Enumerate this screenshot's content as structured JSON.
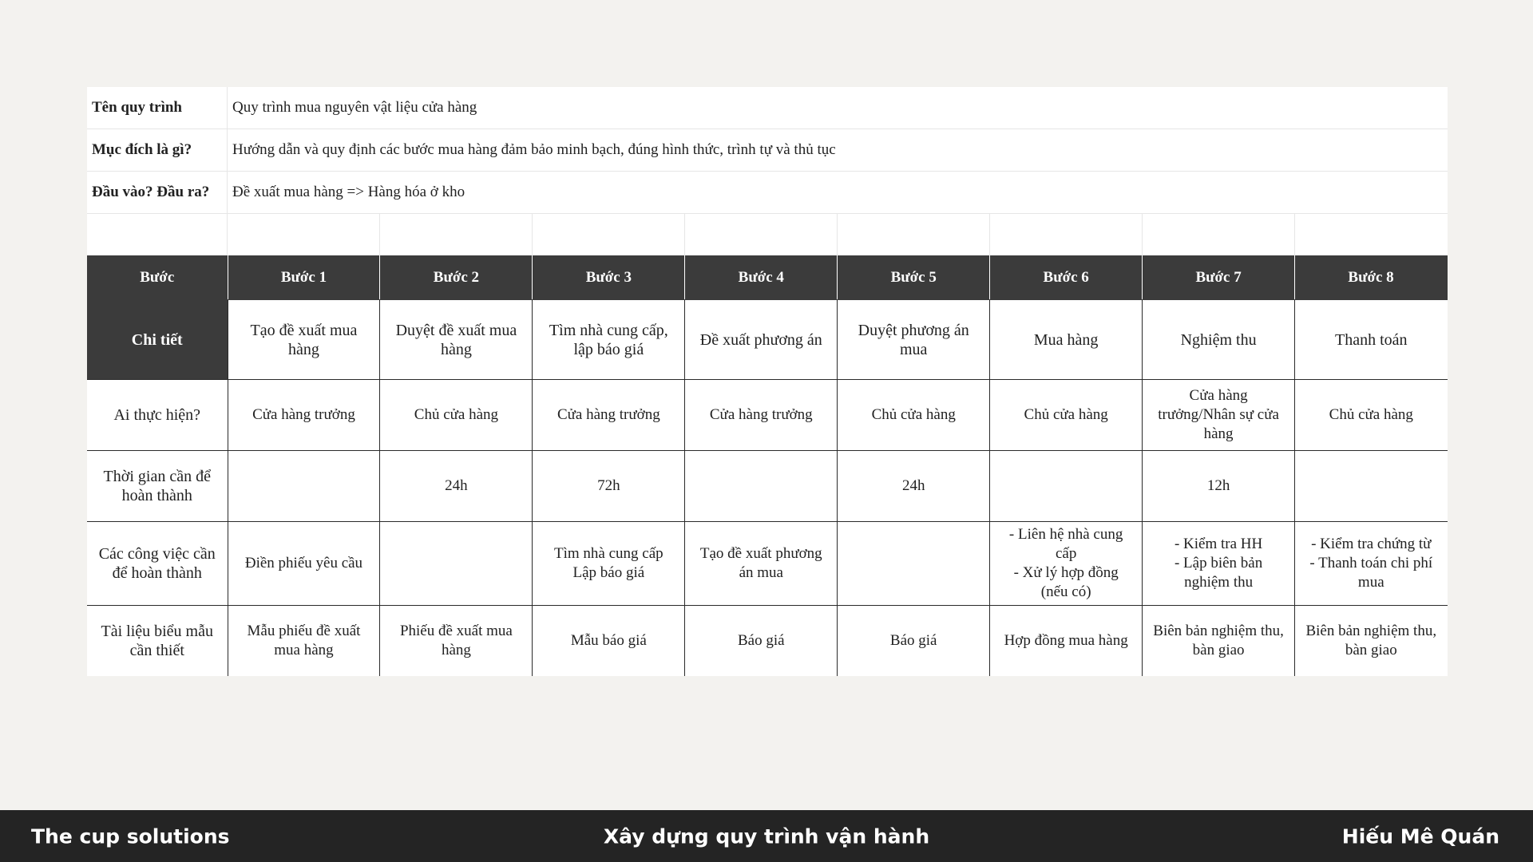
{
  "meta": [
    {
      "label": "Tên quy trình",
      "value": "Quy trình mua nguyên vật liệu cửa hàng"
    },
    {
      "label": "Mục đích là gì?",
      "value": "Hướng dẫn và quy định các bước mua hàng đảm bảo minh bạch, đúng hình thức, trình tự và thủ tục"
    },
    {
      "label": "Đầu vào? Đầu ra?",
      "value": "Đề xuất mua hàng => Hàng hóa ở kho"
    }
  ],
  "table": {
    "header": [
      "Bước",
      "Bước 1",
      "Bước 2",
      "Bước 3",
      "Bước 4",
      "Bước 5",
      "Bước 6",
      "Bước 7",
      "Bước 8"
    ],
    "rows": [
      {
        "label": "Chi tiết",
        "cells": [
          "Tạo đề xuất mua\nhàng",
          "Duyệt đề xuất mua\nhàng",
          "Tìm nhà cung cấp,\nlập báo giá",
          "Đề xuất phương án",
          "Duyệt phương án\nmua",
          "Mua hàng",
          "Nghiệm thu",
          "Thanh toán"
        ]
      },
      {
        "label": "Ai thực hiện?",
        "cells": [
          "Cửa hàng trưởng",
          "Chủ cửa hàng",
          "Cửa hàng trưởng",
          "Cửa hàng trưởng",
          "Chủ cửa hàng",
          "Chủ cửa hàng",
          "Cửa hàng\ntrưởng/Nhân sự cửa\nhàng",
          "Chủ cửa hàng"
        ]
      },
      {
        "label": "Thời gian cần để\nhoàn thành",
        "cells": [
          "",
          "24h",
          "72h",
          "",
          "24h",
          "",
          "12h",
          ""
        ]
      },
      {
        "label": "Các công việc cần\nđể hoàn thành",
        "cells": [
          "Điền phiếu yêu cầu",
          "",
          "Tìm nhà cung cấp\nLập báo giá",
          "Tạo đề xuất phương\nán mua",
          "",
          "- Liên hệ nhà cung\ncấp\n- Xử lý hợp đồng\n(nếu có)",
          "- Kiểm tra HH\n- Lập biên bản\nnghiệm thu",
          "- Kiểm tra chứng từ\n- Thanh toán chi phí\nmua"
        ]
      },
      {
        "label": "Tài liệu biểu mẫu\ncần thiết",
        "cells": [
          "Mẫu phiếu đề xuất\nmua hàng",
          "Phiếu đề xuất mua\nhàng",
          "Mẫu báo giá",
          "Báo giá",
          "Báo giá",
          "Hợp đồng mua hàng",
          "Biên bản nghiệm thu,\nbàn giao",
          "Biên bản nghiệm thu,\nbàn giao"
        ]
      }
    ]
  },
  "footer": {
    "left": "The cup solutions",
    "center": "Xây dựng quy trình vận hành",
    "right": "Hiếu Mê Quán"
  }
}
